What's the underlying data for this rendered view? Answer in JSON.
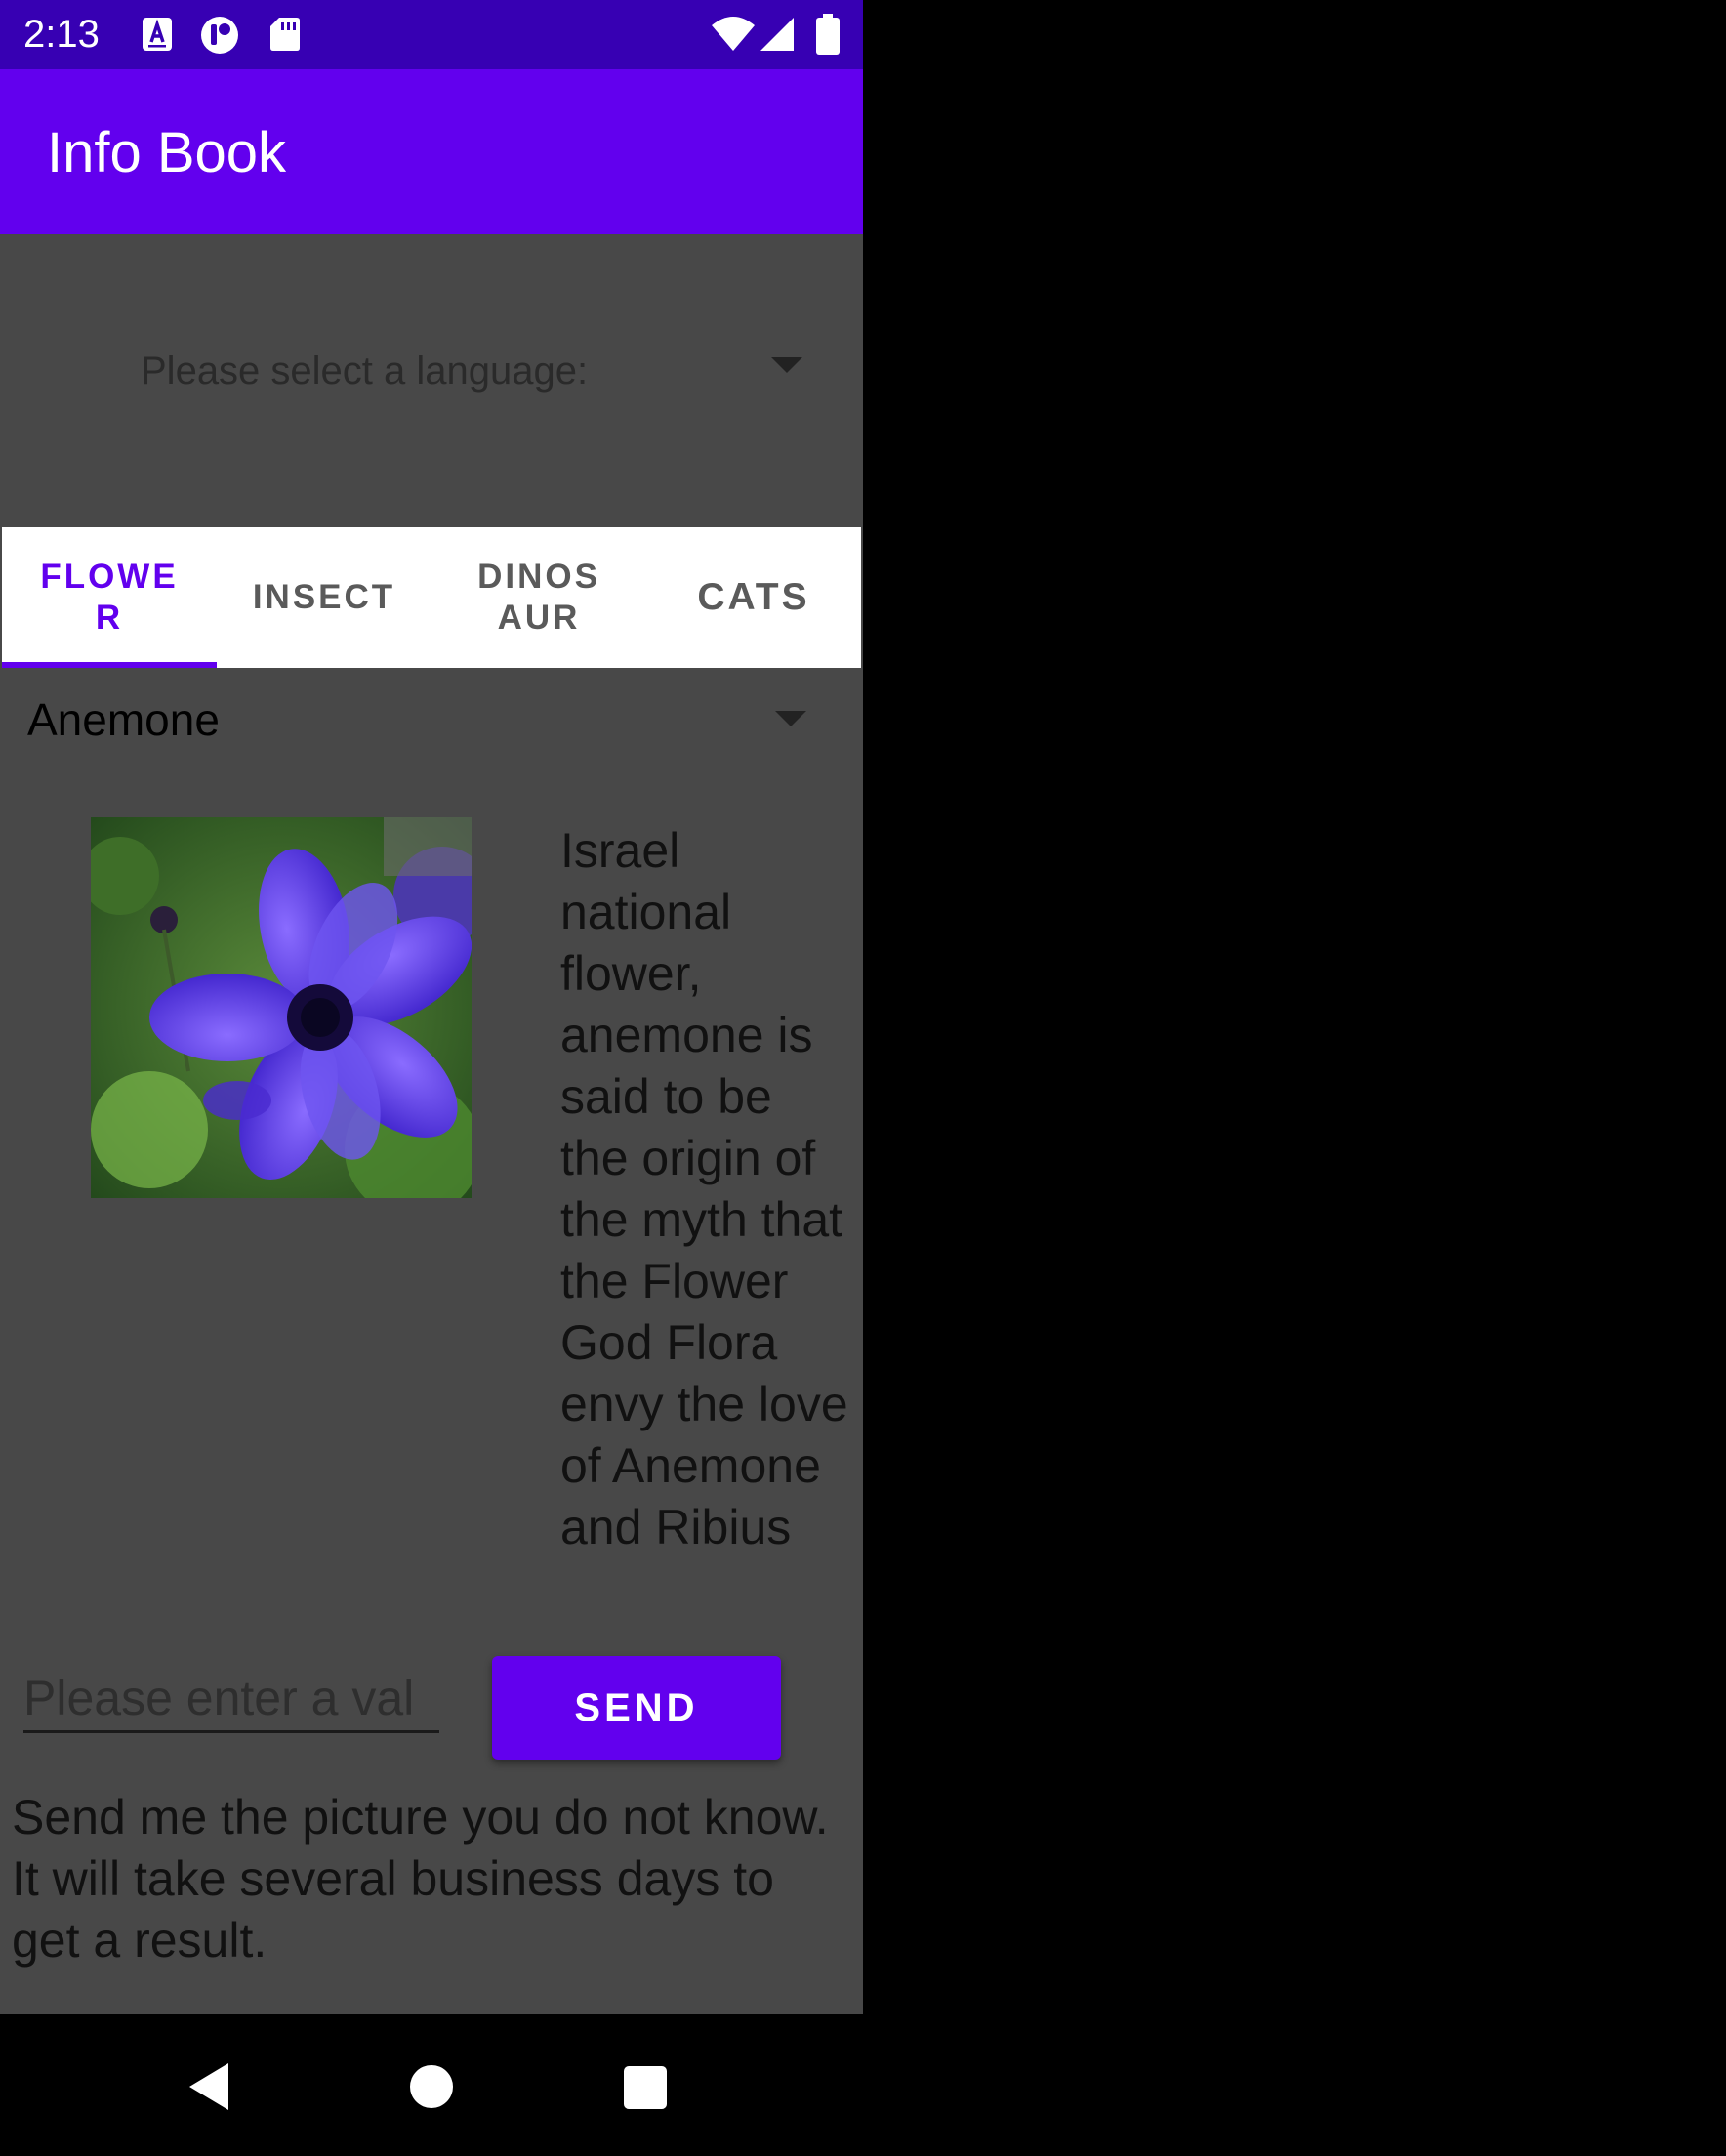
{
  "status_bar": {
    "time": "2:13",
    "icons": [
      "keyboard-icon",
      "app-notification-icon",
      "sd-card-icon",
      "wifi-icon",
      "cell-signal-icon",
      "battery-icon"
    ]
  },
  "app_bar": {
    "title": "Info Book"
  },
  "language_spinner": {
    "text": "Please select a language:",
    "icon": "dropdown-arrow-icon"
  },
  "tabs": [
    {
      "label": "FLOWE\nR",
      "active": true
    },
    {
      "label": "INSECT",
      "active": false
    },
    {
      "label": "DINOS\nAUR",
      "active": false
    },
    {
      "label": "CATS",
      "active": false
    }
  ],
  "item_spinner": {
    "value": "Anemone",
    "icon": "dropdown-arrow-icon"
  },
  "image": {
    "subject": "purple anemone flower"
  },
  "description": "Israel national flower, anemone is said to be the origin of the myth that the Flower God Flora envy the love of Anemone and Ribius",
  "input": {
    "placeholder": "Please enter a val",
    "value": ""
  },
  "send_button": {
    "label": "SEND"
  },
  "help_text": "Send me the picture you do not know. It will take several business days to get a result.",
  "nav_bar": {
    "icons": [
      "back-icon",
      "home-icon",
      "recents-icon"
    ]
  },
  "colors": {
    "status_bar": "#3700b3",
    "primary": "#6200ee",
    "content_bg": "#484848"
  }
}
